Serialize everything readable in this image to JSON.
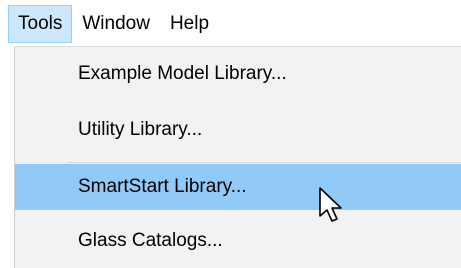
{
  "menubar": {
    "items": [
      {
        "label": "Tools"
      },
      {
        "label": "Window"
      },
      {
        "label": "Help"
      }
    ]
  },
  "tools_menu": {
    "items": [
      {
        "label": "Example Model Library..."
      },
      {
        "label": "Utility Library..."
      },
      {
        "label": "SmartStart Library..."
      },
      {
        "label": "Glass Catalogs..."
      }
    ]
  },
  "colors": {
    "menubar_open_bg": "#cce8ff",
    "menu_bg": "#f2f2f2",
    "highlight_bg": "#91c9f7"
  },
  "icons": {
    "cursor": "arrow-pointer-icon"
  }
}
